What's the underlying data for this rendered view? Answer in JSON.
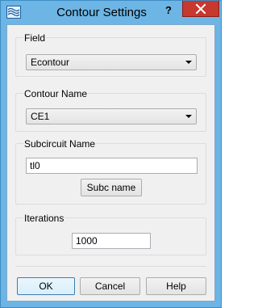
{
  "window": {
    "title": "Contour Settings",
    "help_glyph": "?",
    "app_icon": "wave-app-icon"
  },
  "field_group": {
    "label": "Field",
    "selected": "Econtour"
  },
  "contour_name_group": {
    "label": "Contour Name",
    "selected": "CE1"
  },
  "subcircuit_group": {
    "label": "Subcircuit Name",
    "value": "tl0",
    "button_label": "Subc name"
  },
  "iterations_group": {
    "label": "Iterations",
    "value": "1000"
  },
  "buttons": {
    "ok": "OK",
    "cancel": "Cancel",
    "help": "Help"
  },
  "colors": {
    "titlebar": "#6cb5e5",
    "close_button": "#c7382e",
    "dialog_background": "#f0f0f0"
  }
}
